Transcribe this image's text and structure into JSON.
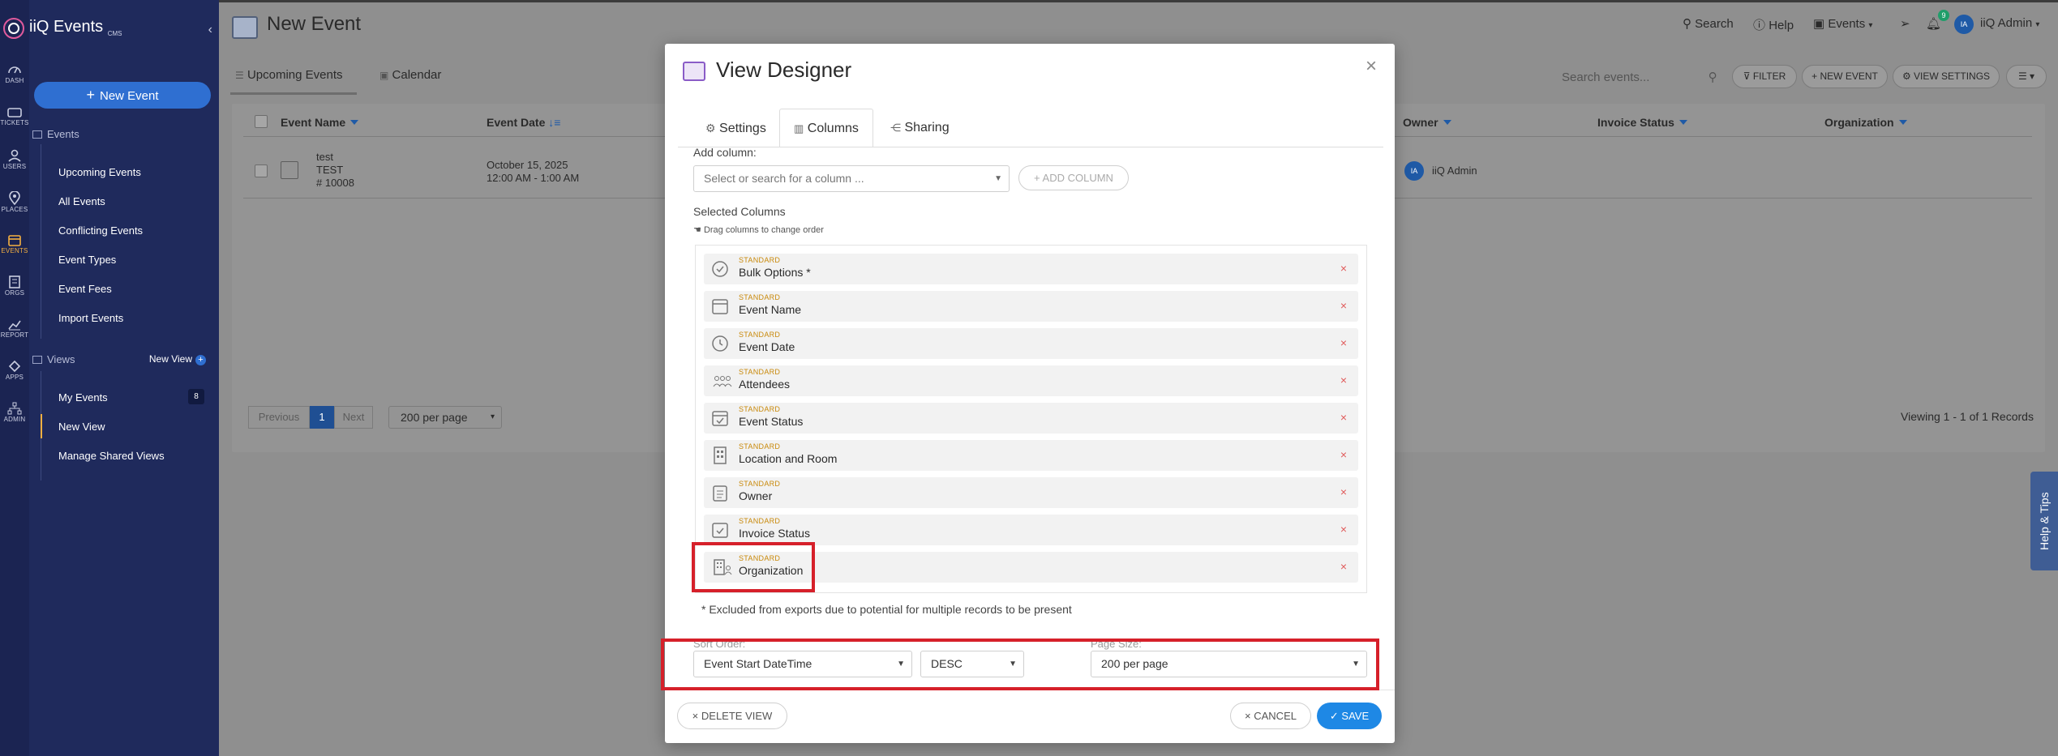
{
  "sidebar": {
    "brand": "iiQ Events",
    "brand_badge": "CMS",
    "collapse": "‹",
    "new_event": "New Event",
    "events_section": "Events",
    "nav": [
      "Upcoming Events",
      "All Events",
      "Conflicting Events",
      "Event Types",
      "Event Fees",
      "Import Events"
    ],
    "views_section": "Views",
    "new_view": "New View",
    "new_view_plus": "+",
    "views": [
      "My Events",
      "New View",
      "Manage Shared Views"
    ],
    "my_events_count": "8"
  },
  "rail": [
    "DASH",
    "TICKETS",
    "USERS",
    "PLACES",
    "EVENTS",
    "ORGS",
    "REPORT",
    "APPS",
    "ADMIN"
  ],
  "header": {
    "title": "New Event",
    "search": "Search",
    "help": "Help",
    "events_menu": "Events",
    "notif_count": "9",
    "user": "iiQ Admin",
    "user_initials": "IA"
  },
  "tabs": {
    "upcoming": "Upcoming Events",
    "calendar": "Calendar"
  },
  "toolbar": {
    "search_placeholder": "Search events...",
    "filter": "FILTER",
    "new_event": "NEW EVENT",
    "view_settings": "VIEW SETTINGS"
  },
  "table": {
    "headers": {
      "event_name": "Event Name",
      "event_date": "Event Date",
      "owner": "Owner",
      "invoice_status": "Invoice Status",
      "organization": "Organization"
    },
    "row": {
      "name": "test",
      "type": "TEST",
      "number": "# 10008",
      "date": "October 15, 2025",
      "time": "12:00 AM - 1:00 AM",
      "owner": "iiQ Admin",
      "owner_initials": "IA"
    }
  },
  "pager": {
    "previous": "Previous",
    "page": "1",
    "next": "Next",
    "per_page": "200 per page",
    "viewing": "Viewing 1 - 1 of 1 Records"
  },
  "help_tips": "Help & Tips",
  "modal": {
    "title": "View Designer",
    "close": "×",
    "tabs": [
      "Settings",
      "Columns",
      "Sharing"
    ],
    "add_column_label": "Add column:",
    "add_column_placeholder": "Select or search for a column ...",
    "add_column_button": "+ ADD COLUMN",
    "selected_label": "Selected Columns",
    "drag_hint": "Drag columns to change order",
    "columns": [
      {
        "kind": "STANDARD",
        "name": "Bulk Options *"
      },
      {
        "kind": "STANDARD",
        "name": "Event Name"
      },
      {
        "kind": "STANDARD",
        "name": "Event Date"
      },
      {
        "kind": "STANDARD",
        "name": "Attendees"
      },
      {
        "kind": "STANDARD",
        "name": "Event Status"
      },
      {
        "kind": "STANDARD",
        "name": "Location and Room"
      },
      {
        "kind": "STANDARD",
        "name": "Owner"
      },
      {
        "kind": "STANDARD",
        "name": "Invoice Status"
      },
      {
        "kind": "STANDARD",
        "name": "Organization"
      }
    ],
    "remove_glyph": "×",
    "footnote": "* Excluded from exports due to potential for multiple records to be present",
    "sort_order_label": "Sort Order:",
    "page_size_label": "Page Size:",
    "sort_field": "Event Start DateTime",
    "sort_dir": "DESC",
    "page_size": "200 per page",
    "delete_view": "DELETE VIEW",
    "cancel": "CANCEL",
    "save": "SAVE"
  },
  "colors": {
    "accent": "#1e88e5",
    "sidebar": "#1f2a5c",
    "highlight": "#d6202a",
    "standard_tag": "#c9890a"
  }
}
